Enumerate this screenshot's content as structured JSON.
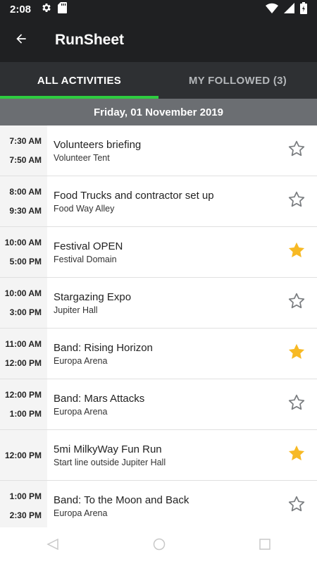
{
  "status": {
    "time": "2:08"
  },
  "app": {
    "title": "RunSheet"
  },
  "tabs": [
    {
      "label": "ALL ACTIVITIES"
    },
    {
      "label": "MY FOLLOWED (3)"
    }
  ],
  "date_header": "Friday, 01 November 2019",
  "colors": {
    "accent": "#2ecc40",
    "star_filled": "#f7b924",
    "star_outline": "#7a7d80",
    "bar": "#1f2022"
  },
  "activities": [
    {
      "start": "7:30 AM",
      "end": "7:50 AM",
      "title": "Volunteers briefing",
      "location": "Volunteer Tent",
      "followed": false
    },
    {
      "start": "8:00 AM",
      "end": "9:30 AM",
      "title": "Food Trucks and contractor set up",
      "location": "Food Way Alley",
      "followed": false
    },
    {
      "start": "10:00 AM",
      "end": "5:00 PM",
      "title": "Festival OPEN",
      "location": "Festival Domain",
      "followed": true
    },
    {
      "start": "10:00 AM",
      "end": "3:00 PM",
      "title": "Stargazing Expo",
      "location": "Jupiter Hall",
      "followed": false
    },
    {
      "start": "11:00 AM",
      "end": "12:00 PM",
      "title": "Band: Rising Horizon",
      "location": "Europa Arena",
      "followed": true
    },
    {
      "start": "12:00 PM",
      "end": "1:00 PM",
      "title": "Band: Mars Attacks",
      "location": "Europa Arena",
      "followed": false
    },
    {
      "start": "12:00 PM",
      "end": "",
      "title": "5mi MilkyWay Fun Run",
      "location": "Start line outside  Jupiter Hall",
      "followed": true
    },
    {
      "start": "1:00 PM",
      "end": "2:30 PM",
      "title": "Band: To the Moon and Back",
      "location": "Europa Arena",
      "followed": false
    }
  ]
}
